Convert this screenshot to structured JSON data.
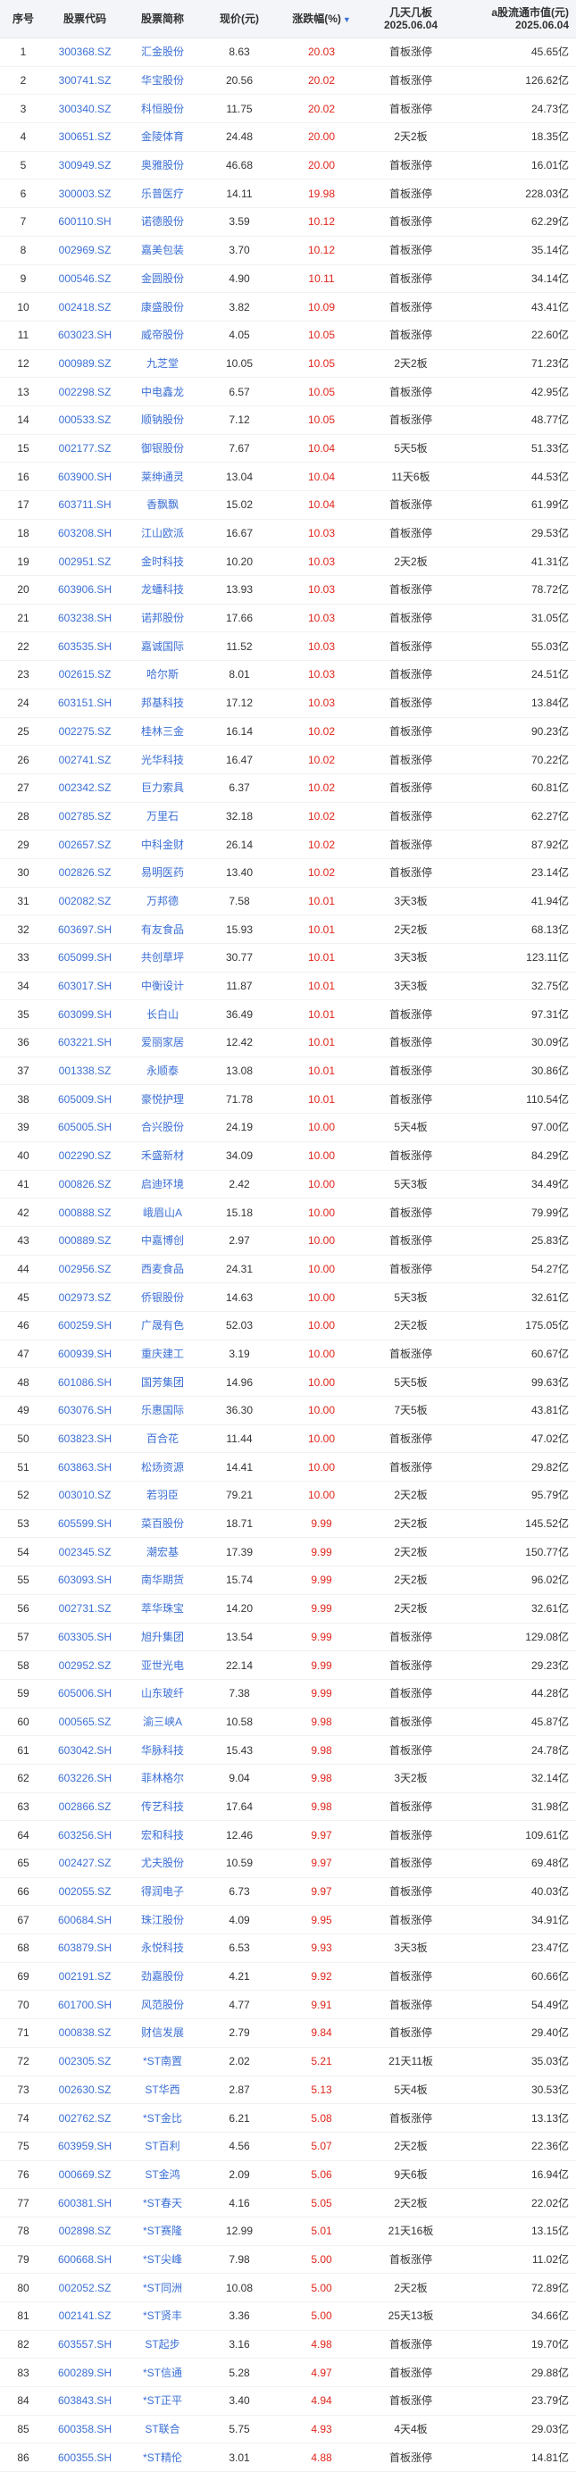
{
  "header": {
    "idx": "序号",
    "code": "股票代码",
    "name": "股票简称",
    "price": "现价(元)",
    "pct": "涨跌幅(%)",
    "sort_icon": "▼",
    "board_l1": "几天几板",
    "board_l2": "2025.06.04",
    "cap_l1": "a股流通市值(元)",
    "cap_l2": "2025.06.04"
  },
  "colors": {
    "up": "#e1251b",
    "link": "#3b6fd6",
    "header_bg": "#f3f5f8"
  },
  "rows": [
    {
      "idx": "1",
      "code": "300368.SZ",
      "name": "汇金股份",
      "price": "8.63",
      "pct": "20.03",
      "board": "首板涨停",
      "cap": "45.65亿"
    },
    {
      "idx": "2",
      "code": "300741.SZ",
      "name": "华宝股份",
      "price": "20.56",
      "pct": "20.02",
      "board": "首板涨停",
      "cap": "126.62亿"
    },
    {
      "idx": "3",
      "code": "300340.SZ",
      "name": "科恒股份",
      "price": "11.75",
      "pct": "20.02",
      "board": "首板涨停",
      "cap": "24.73亿"
    },
    {
      "idx": "4",
      "code": "300651.SZ",
      "name": "金陵体育",
      "price": "24.48",
      "pct": "20.00",
      "board": "2天2板",
      "cap": "18.35亿"
    },
    {
      "idx": "5",
      "code": "300949.SZ",
      "name": "奥雅股份",
      "price": "46.68",
      "pct": "20.00",
      "board": "首板涨停",
      "cap": "16.01亿"
    },
    {
      "idx": "6",
      "code": "300003.SZ",
      "name": "乐普医疗",
      "price": "14.11",
      "pct": "19.98",
      "board": "首板涨停",
      "cap": "228.03亿"
    },
    {
      "idx": "7",
      "code": "600110.SH",
      "name": "诺德股份",
      "price": "3.59",
      "pct": "10.12",
      "board": "首板涨停",
      "cap": "62.29亿"
    },
    {
      "idx": "8",
      "code": "002969.SZ",
      "name": "嘉美包装",
      "price": "3.70",
      "pct": "10.12",
      "board": "首板涨停",
      "cap": "35.14亿"
    },
    {
      "idx": "9",
      "code": "000546.SZ",
      "name": "金圆股份",
      "price": "4.90",
      "pct": "10.11",
      "board": "首板涨停",
      "cap": "34.14亿"
    },
    {
      "idx": "10",
      "code": "002418.SZ",
      "name": "康盛股份",
      "price": "3.82",
      "pct": "10.09",
      "board": "首板涨停",
      "cap": "43.41亿"
    },
    {
      "idx": "11",
      "code": "603023.SH",
      "name": "威帝股份",
      "price": "4.05",
      "pct": "10.05",
      "board": "首板涨停",
      "cap": "22.60亿"
    },
    {
      "idx": "12",
      "code": "000989.SZ",
      "name": "九芝堂",
      "price": "10.05",
      "pct": "10.05",
      "board": "2天2板",
      "cap": "71.23亿"
    },
    {
      "idx": "13",
      "code": "002298.SZ",
      "name": "中电鑫龙",
      "price": "6.57",
      "pct": "10.05",
      "board": "首板涨停",
      "cap": "42.95亿"
    },
    {
      "idx": "14",
      "code": "000533.SZ",
      "name": "顺钠股份",
      "price": "7.12",
      "pct": "10.05",
      "board": "首板涨停",
      "cap": "48.77亿"
    },
    {
      "idx": "15",
      "code": "002177.SZ",
      "name": "御银股份",
      "price": "7.67",
      "pct": "10.04",
      "board": "5天5板",
      "cap": "51.33亿"
    },
    {
      "idx": "16",
      "code": "603900.SH",
      "name": "莱绅通灵",
      "price": "13.04",
      "pct": "10.04",
      "board": "11天6板",
      "cap": "44.53亿"
    },
    {
      "idx": "17",
      "code": "603711.SH",
      "name": "香飘飘",
      "price": "15.02",
      "pct": "10.04",
      "board": "首板涨停",
      "cap": "61.99亿"
    },
    {
      "idx": "18",
      "code": "603208.SH",
      "name": "江山欧派",
      "price": "16.67",
      "pct": "10.03",
      "board": "首板涨停",
      "cap": "29.53亿"
    },
    {
      "idx": "19",
      "code": "002951.SZ",
      "name": "金时科技",
      "price": "10.20",
      "pct": "10.03",
      "board": "2天2板",
      "cap": "41.31亿"
    },
    {
      "idx": "20",
      "code": "603906.SH",
      "name": "龙蟠科技",
      "price": "13.93",
      "pct": "10.03",
      "board": "首板涨停",
      "cap": "78.72亿"
    },
    {
      "idx": "21",
      "code": "603238.SH",
      "name": "诺邦股份",
      "price": "17.66",
      "pct": "10.03",
      "board": "首板涨停",
      "cap": "31.05亿"
    },
    {
      "idx": "22",
      "code": "603535.SH",
      "name": "嘉诚国际",
      "price": "11.52",
      "pct": "10.03",
      "board": "首板涨停",
      "cap": "55.03亿"
    },
    {
      "idx": "23",
      "code": "002615.SZ",
      "name": "哈尔斯",
      "price": "8.01",
      "pct": "10.03",
      "board": "首板涨停",
      "cap": "24.51亿"
    },
    {
      "idx": "24",
      "code": "603151.SH",
      "name": "邦基科技",
      "price": "17.12",
      "pct": "10.03",
      "board": "首板涨停",
      "cap": "13.84亿"
    },
    {
      "idx": "25",
      "code": "002275.SZ",
      "name": "桂林三金",
      "price": "16.14",
      "pct": "10.02",
      "board": "首板涨停",
      "cap": "90.23亿"
    },
    {
      "idx": "26",
      "code": "002741.SZ",
      "name": "光华科技",
      "price": "16.47",
      "pct": "10.02",
      "board": "首板涨停",
      "cap": "70.22亿"
    },
    {
      "idx": "27",
      "code": "002342.SZ",
      "name": "巨力索具",
      "price": "6.37",
      "pct": "10.02",
      "board": "首板涨停",
      "cap": "60.81亿"
    },
    {
      "idx": "28",
      "code": "002785.SZ",
      "name": "万里石",
      "price": "32.18",
      "pct": "10.02",
      "board": "首板涨停",
      "cap": "62.27亿"
    },
    {
      "idx": "29",
      "code": "002657.SZ",
      "name": "中科金财",
      "price": "26.14",
      "pct": "10.02",
      "board": "首板涨停",
      "cap": "87.92亿"
    },
    {
      "idx": "30",
      "code": "002826.SZ",
      "name": "易明医药",
      "price": "13.40",
      "pct": "10.02",
      "board": "首板涨停",
      "cap": "23.14亿"
    },
    {
      "idx": "31",
      "code": "002082.SZ",
      "name": "万邦德",
      "price": "7.58",
      "pct": "10.01",
      "board": "3天3板",
      "cap": "41.94亿"
    },
    {
      "idx": "32",
      "code": "603697.SH",
      "name": "有友食品",
      "price": "15.93",
      "pct": "10.01",
      "board": "2天2板",
      "cap": "68.13亿"
    },
    {
      "idx": "33",
      "code": "605099.SH",
      "name": "共创草坪",
      "price": "30.77",
      "pct": "10.01",
      "board": "3天3板",
      "cap": "123.11亿"
    },
    {
      "idx": "34",
      "code": "603017.SH",
      "name": "中衡设计",
      "price": "11.87",
      "pct": "10.01",
      "board": "3天3板",
      "cap": "32.75亿"
    },
    {
      "idx": "35",
      "code": "603099.SH",
      "name": "长白山",
      "price": "36.49",
      "pct": "10.01",
      "board": "首板涨停",
      "cap": "97.31亿"
    },
    {
      "idx": "36",
      "code": "603221.SH",
      "name": "爱丽家居",
      "price": "12.42",
      "pct": "10.01",
      "board": "首板涨停",
      "cap": "30.09亿"
    },
    {
      "idx": "37",
      "code": "001338.SZ",
      "name": "永顺泰",
      "price": "13.08",
      "pct": "10.01",
      "board": "首板涨停",
      "cap": "30.86亿"
    },
    {
      "idx": "38",
      "code": "605009.SH",
      "name": "豪悦护理",
      "price": "71.78",
      "pct": "10.01",
      "board": "首板涨停",
      "cap": "110.54亿"
    },
    {
      "idx": "39",
      "code": "605005.SH",
      "name": "合兴股份",
      "price": "24.19",
      "pct": "10.00",
      "board": "5天4板",
      "cap": "97.00亿"
    },
    {
      "idx": "40",
      "code": "002290.SZ",
      "name": "禾盛新材",
      "price": "34.09",
      "pct": "10.00",
      "board": "首板涨停",
      "cap": "84.29亿"
    },
    {
      "idx": "41",
      "code": "000826.SZ",
      "name": "启迪环境",
      "price": "2.42",
      "pct": "10.00",
      "board": "5天3板",
      "cap": "34.49亿"
    },
    {
      "idx": "42",
      "code": "000888.SZ",
      "name": "峨眉山A",
      "price": "15.18",
      "pct": "10.00",
      "board": "首板涨停",
      "cap": "79.99亿"
    },
    {
      "idx": "43",
      "code": "000889.SZ",
      "name": "中嘉博创",
      "price": "2.97",
      "pct": "10.00",
      "board": "首板涨停",
      "cap": "25.83亿"
    },
    {
      "idx": "44",
      "code": "002956.SZ",
      "name": "西麦食品",
      "price": "24.31",
      "pct": "10.00",
      "board": "首板涨停",
      "cap": "54.27亿"
    },
    {
      "idx": "45",
      "code": "002973.SZ",
      "name": "侨银股份",
      "price": "14.63",
      "pct": "10.00",
      "board": "5天3板",
      "cap": "32.61亿"
    },
    {
      "idx": "46",
      "code": "600259.SH",
      "name": "广晟有色",
      "price": "52.03",
      "pct": "10.00",
      "board": "2天2板",
      "cap": "175.05亿"
    },
    {
      "idx": "47",
      "code": "600939.SH",
      "name": "重庆建工",
      "price": "3.19",
      "pct": "10.00",
      "board": "首板涨停",
      "cap": "60.67亿"
    },
    {
      "idx": "48",
      "code": "601086.SH",
      "name": "国芳集团",
      "price": "14.96",
      "pct": "10.00",
      "board": "5天5板",
      "cap": "99.63亿"
    },
    {
      "idx": "49",
      "code": "603076.SH",
      "name": "乐惠国际",
      "price": "36.30",
      "pct": "10.00",
      "board": "7天5板",
      "cap": "43.81亿"
    },
    {
      "idx": "50",
      "code": "603823.SH",
      "name": "百合花",
      "price": "11.44",
      "pct": "10.00",
      "board": "首板涨停",
      "cap": "47.02亿"
    },
    {
      "idx": "51",
      "code": "603863.SH",
      "name": "松炀资源",
      "price": "14.41",
      "pct": "10.00",
      "board": "首板涨停",
      "cap": "29.82亿"
    },
    {
      "idx": "52",
      "code": "003010.SZ",
      "name": "若羽臣",
      "price": "79.21",
      "pct": "10.00",
      "board": "2天2板",
      "cap": "95.79亿"
    },
    {
      "idx": "53",
      "code": "605599.SH",
      "name": "菜百股份",
      "price": "18.71",
      "pct": "9.99",
      "board": "2天2板",
      "cap": "145.52亿"
    },
    {
      "idx": "54",
      "code": "002345.SZ",
      "name": "潮宏基",
      "price": "17.39",
      "pct": "9.99",
      "board": "2天2板",
      "cap": "150.77亿"
    },
    {
      "idx": "55",
      "code": "603093.SH",
      "name": "南华期货",
      "price": "15.74",
      "pct": "9.99",
      "board": "2天2板",
      "cap": "96.02亿"
    },
    {
      "idx": "56",
      "code": "002731.SZ",
      "name": "萃华珠宝",
      "price": "14.20",
      "pct": "9.99",
      "board": "2天2板",
      "cap": "32.61亿"
    },
    {
      "idx": "57",
      "code": "603305.SH",
      "name": "旭升集团",
      "price": "13.54",
      "pct": "9.99",
      "board": "首板涨停",
      "cap": "129.08亿"
    },
    {
      "idx": "58",
      "code": "002952.SZ",
      "name": "亚世光电",
      "price": "22.14",
      "pct": "9.99",
      "board": "首板涨停",
      "cap": "29.23亿"
    },
    {
      "idx": "59",
      "code": "605006.SH",
      "name": "山东玻纤",
      "price": "7.38",
      "pct": "9.99",
      "board": "首板涨停",
      "cap": "44.28亿"
    },
    {
      "idx": "60",
      "code": "000565.SZ",
      "name": "渝三峡A",
      "price": "10.58",
      "pct": "9.98",
      "board": "首板涨停",
      "cap": "45.87亿"
    },
    {
      "idx": "61",
      "code": "603042.SH",
      "name": "华脉科技",
      "price": "15.43",
      "pct": "9.98",
      "board": "首板涨停",
      "cap": "24.78亿"
    },
    {
      "idx": "62",
      "code": "603226.SH",
      "name": "菲林格尔",
      "price": "9.04",
      "pct": "9.98",
      "board": "3天2板",
      "cap": "32.14亿"
    },
    {
      "idx": "63",
      "code": "002866.SZ",
      "name": "传艺科技",
      "price": "17.64",
      "pct": "9.98",
      "board": "首板涨停",
      "cap": "31.98亿"
    },
    {
      "idx": "64",
      "code": "603256.SH",
      "name": "宏和科技",
      "price": "12.46",
      "pct": "9.97",
      "board": "首板涨停",
      "cap": "109.61亿"
    },
    {
      "idx": "65",
      "code": "002427.SZ",
      "name": "尤夫股份",
      "price": "10.59",
      "pct": "9.97",
      "board": "首板涨停",
      "cap": "69.48亿"
    },
    {
      "idx": "66",
      "code": "002055.SZ",
      "name": "得润电子",
      "price": "6.73",
      "pct": "9.97",
      "board": "首板涨停",
      "cap": "40.03亿"
    },
    {
      "idx": "67",
      "code": "600684.SH",
      "name": "珠江股份",
      "price": "4.09",
      "pct": "9.95",
      "board": "首板涨停",
      "cap": "34.91亿"
    },
    {
      "idx": "68",
      "code": "603879.SH",
      "name": "永悦科技",
      "price": "6.53",
      "pct": "9.93",
      "board": "3天3板",
      "cap": "23.47亿"
    },
    {
      "idx": "69",
      "code": "002191.SZ",
      "name": "劲嘉股份",
      "price": "4.21",
      "pct": "9.92",
      "board": "首板涨停",
      "cap": "60.66亿"
    },
    {
      "idx": "70",
      "code": "601700.SH",
      "name": "风范股份",
      "price": "4.77",
      "pct": "9.91",
      "board": "首板涨停",
      "cap": "54.49亿"
    },
    {
      "idx": "71",
      "code": "000838.SZ",
      "name": "财信发展",
      "price": "2.79",
      "pct": "9.84",
      "board": "首板涨停",
      "cap": "29.40亿"
    },
    {
      "idx": "72",
      "code": "002305.SZ",
      "name": "*ST南置",
      "price": "2.02",
      "pct": "5.21",
      "board": "21天11板",
      "cap": "35.03亿"
    },
    {
      "idx": "73",
      "code": "002630.SZ",
      "name": "ST华西",
      "price": "2.87",
      "pct": "5.13",
      "board": "5天4板",
      "cap": "30.53亿"
    },
    {
      "idx": "74",
      "code": "002762.SZ",
      "name": "*ST金比",
      "price": "6.21",
      "pct": "5.08",
      "board": "首板涨停",
      "cap": "13.13亿"
    },
    {
      "idx": "75",
      "code": "603959.SH",
      "name": "ST百利",
      "price": "4.56",
      "pct": "5.07",
      "board": "2天2板",
      "cap": "22.36亿"
    },
    {
      "idx": "76",
      "code": "000669.SZ",
      "name": "ST金鸿",
      "price": "2.09",
      "pct": "5.06",
      "board": "9天6板",
      "cap": "16.94亿"
    },
    {
      "idx": "77",
      "code": "600381.SH",
      "name": "*ST春天",
      "price": "4.16",
      "pct": "5.05",
      "board": "2天2板",
      "cap": "22.02亿"
    },
    {
      "idx": "78",
      "code": "002898.SZ",
      "name": "*ST赛隆",
      "price": "12.99",
      "pct": "5.01",
      "board": "21天16板",
      "cap": "13.15亿"
    },
    {
      "idx": "79",
      "code": "600668.SH",
      "name": "*ST尖峰",
      "price": "7.98",
      "pct": "5.00",
      "board": "首板涨停",
      "cap": "11.02亿"
    },
    {
      "idx": "80",
      "code": "002052.SZ",
      "name": "*ST同洲",
      "price": "10.08",
      "pct": "5.00",
      "board": "2天2板",
      "cap": "72.89亿"
    },
    {
      "idx": "81",
      "code": "002141.SZ",
      "name": "*ST贤丰",
      "price": "3.36",
      "pct": "5.00",
      "board": "25天13板",
      "cap": "34.66亿"
    },
    {
      "idx": "82",
      "code": "603557.SH",
      "name": "ST起步",
      "price": "3.16",
      "pct": "4.98",
      "board": "首板涨停",
      "cap": "19.70亿"
    },
    {
      "idx": "83",
      "code": "600289.SH",
      "name": "*ST信通",
      "price": "5.28",
      "pct": "4.97",
      "board": "首板涨停",
      "cap": "29.88亿"
    },
    {
      "idx": "84",
      "code": "603843.SH",
      "name": "*ST正平",
      "price": "3.40",
      "pct": "4.94",
      "board": "首板涨停",
      "cap": "23.79亿"
    },
    {
      "idx": "85",
      "code": "600358.SH",
      "name": "ST联合",
      "price": "5.75",
      "pct": "4.93",
      "board": "4天4板",
      "cap": "29.03亿"
    },
    {
      "idx": "86",
      "code": "600355.SH",
      "name": "*ST精伦",
      "price": "3.01",
      "pct": "4.88",
      "board": "首板涨停",
      "cap": "14.81亿"
    }
  ]
}
